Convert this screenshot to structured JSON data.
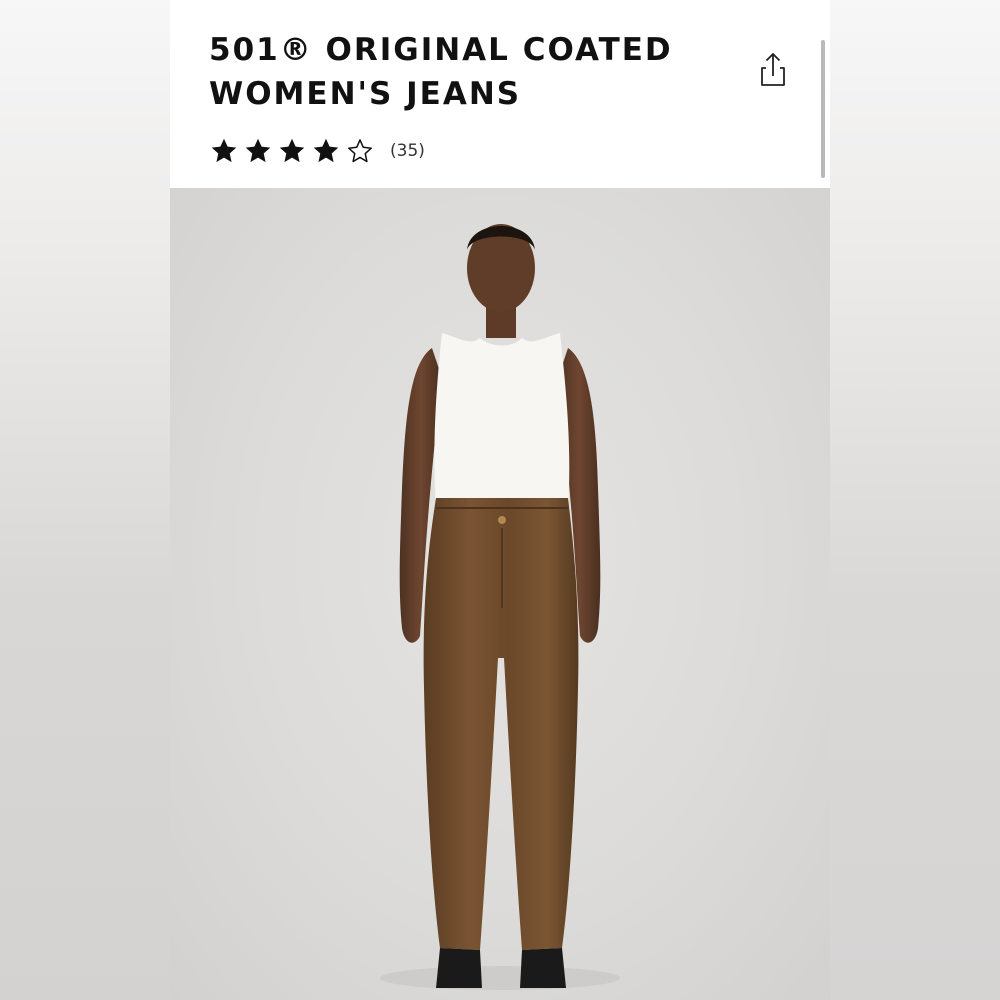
{
  "product": {
    "title_line1": "501® ORIGINAL COATED",
    "title_line2": "WOMEN'S JEANS",
    "rating": 4,
    "rating_max": 5,
    "review_count": "(35)"
  },
  "icons": {
    "share": "share-icon",
    "star_filled": "star-filled-icon",
    "star_empty": "star-outline-icon"
  },
  "colors": {
    "title": "#111111",
    "star": "#111111",
    "photo_bg": "#dcdbd9",
    "pants": "#6b4a2b",
    "top": "#f7f6f2"
  }
}
